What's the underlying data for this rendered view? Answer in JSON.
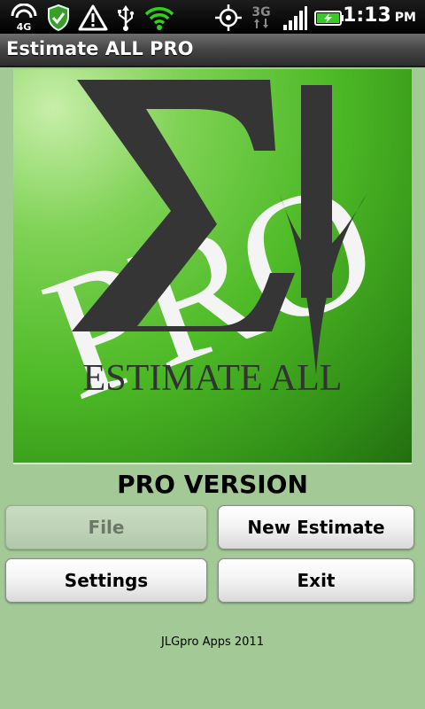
{
  "status_bar": {
    "network_label": "4G",
    "mobile_data_label": "3G",
    "time": "1:13",
    "ampm": "PM",
    "icons": [
      "4g-signal-icon",
      "shield-check-icon",
      "warning-icon",
      "usb-icon",
      "wifi-icon",
      "gps-icon",
      "3g-data-icon",
      "cell-signal-icon",
      "battery-charging-icon"
    ]
  },
  "app": {
    "title": "Estimate ALL PRO"
  },
  "logo": {
    "word": "PRO",
    "caption": "ESTIMATE ALL",
    "icons": [
      "sigma-icon",
      "down-arrow-icon"
    ]
  },
  "main": {
    "version_label": "PRO VERSION",
    "buttons": {
      "file": "File",
      "new_estimate": "New Estimate",
      "settings": "Settings",
      "exit": "Exit"
    },
    "footer": "JLGpro Apps 2011"
  },
  "colors": {
    "background": "#a3c996",
    "logo_green": "#4dba26",
    "logo_dark": "#333333",
    "disabled_text": "#6b7867"
  }
}
